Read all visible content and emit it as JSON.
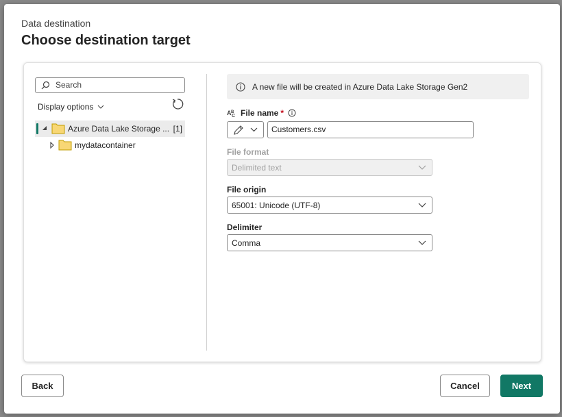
{
  "dialog": {
    "subtitle": "Data destination",
    "title": "Choose destination target"
  },
  "left_pane": {
    "search_placeholder": "Search",
    "display_options": "Display options",
    "tree": [
      {
        "label": "Azure Data Lake Storage ...",
        "count": "[1]",
        "expanded": true,
        "selected": true
      },
      {
        "label": "mydatacontainer",
        "expanded": false,
        "selected": false
      }
    ]
  },
  "right_pane": {
    "info_message": "A new file will be created in Azure Data Lake Storage Gen2",
    "file_name": {
      "label": "File name",
      "required_mark": "*",
      "value": "Customers.csv"
    },
    "file_format": {
      "label": "File format",
      "value": "Delimited text",
      "disabled": true
    },
    "file_origin": {
      "label": "File origin",
      "value": "65001: Unicode (UTF-8)"
    },
    "delimiter": {
      "label": "Delimiter",
      "value": "Comma"
    }
  },
  "footer": {
    "back": "Back",
    "cancel": "Cancel",
    "next": "Next"
  },
  "colors": {
    "accent": "#117865",
    "required": "#c50f1f",
    "folder": "#f8d775"
  }
}
